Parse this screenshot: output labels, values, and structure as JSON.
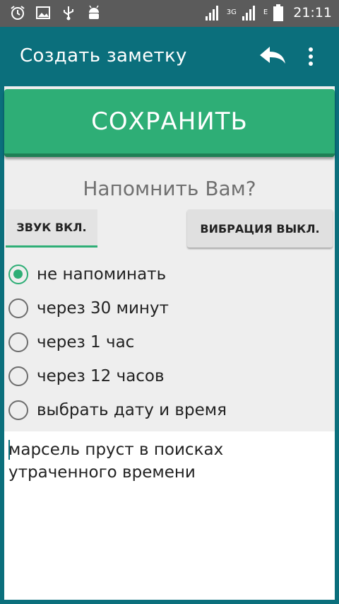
{
  "status_bar": {
    "time": "21:11",
    "network": "3G",
    "network2": "E",
    "icons": [
      "alarm-icon",
      "image-icon",
      "usb-icon",
      "android-icon",
      "signal-icon",
      "battery-icon"
    ]
  },
  "toolbar": {
    "title": "Создать заметку",
    "undo_icon": "undo-icon",
    "more_icon": "more-vert-icon"
  },
  "main": {
    "save_label": "СОХРАНИТЬ",
    "remind_question": "Напомнить Вам?",
    "sound_label": "ЗВУК ВКЛ.",
    "vibration_label": "ВИБРАЦИЯ ВЫКЛ.",
    "reminder_options": [
      {
        "label": "не напоминать",
        "checked": true
      },
      {
        "label": "через 30 минут",
        "checked": false
      },
      {
        "label": "через 1 час",
        "checked": false
      },
      {
        "label": "через 12 часов",
        "checked": false
      },
      {
        "label": "выбрать дату и время",
        "checked": false
      }
    ],
    "note_text": "марсель пруст в поисках утраченного времени"
  },
  "colors": {
    "primary": "#0b6f7c",
    "accent": "#2eae76",
    "status_bar": "#5b5b5b"
  }
}
